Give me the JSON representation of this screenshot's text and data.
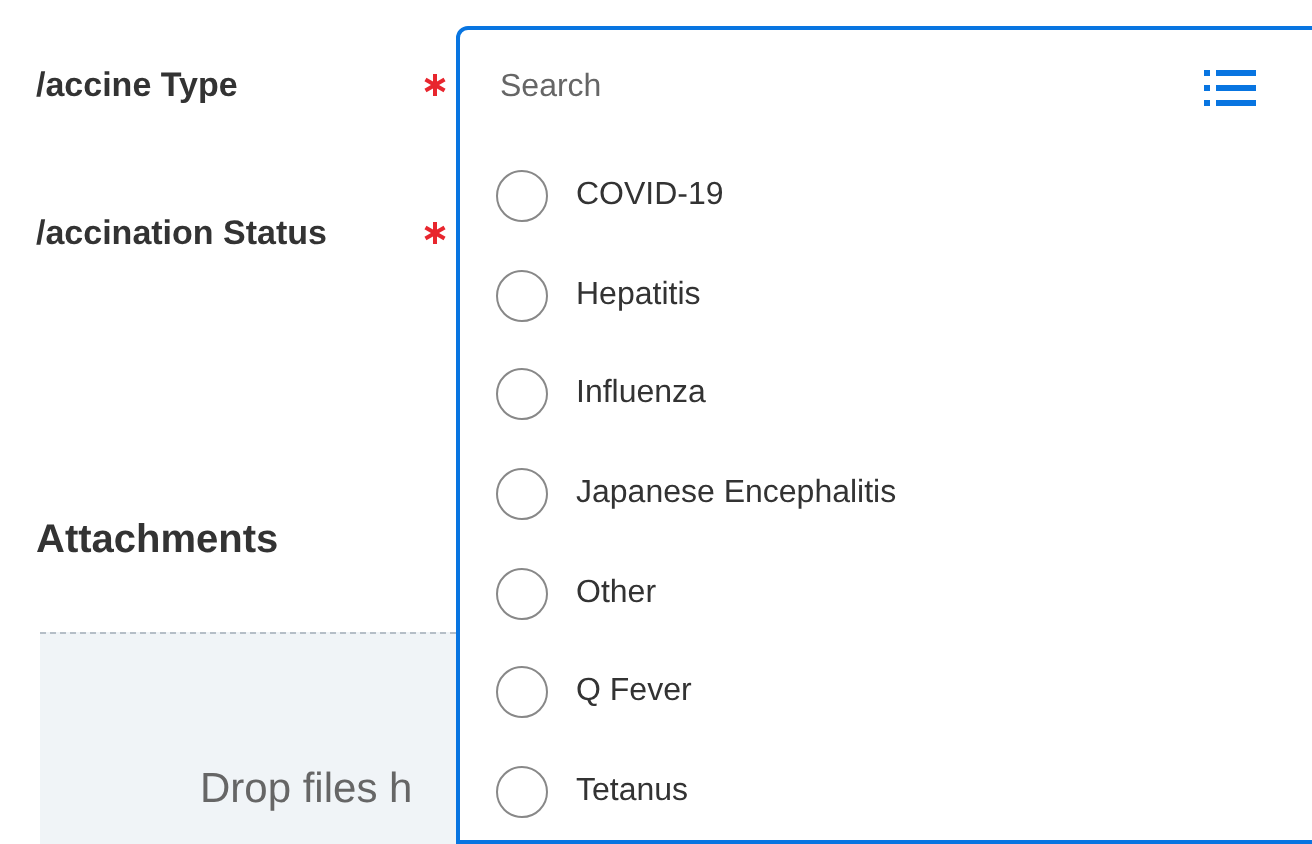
{
  "form": {
    "fields": [
      {
        "label": "/accine Type",
        "required": true
      },
      {
        "label": "/accination Status",
        "required": true
      }
    ],
    "attachments": {
      "title": "Attachments",
      "drop_text": "Drop files h"
    }
  },
  "dropdown": {
    "search": {
      "placeholder": "Search"
    },
    "options": [
      {
        "label": "COVID-19",
        "selected": false
      },
      {
        "label": "Hepatitis",
        "selected": false
      },
      {
        "label": "Influenza",
        "selected": false
      },
      {
        "label": "Japanese Encephalitis",
        "selected": false
      },
      {
        "label": "Other",
        "selected": false
      },
      {
        "label": "Q Fever",
        "selected": false
      },
      {
        "label": "Tetanus",
        "selected": false
      }
    ]
  }
}
